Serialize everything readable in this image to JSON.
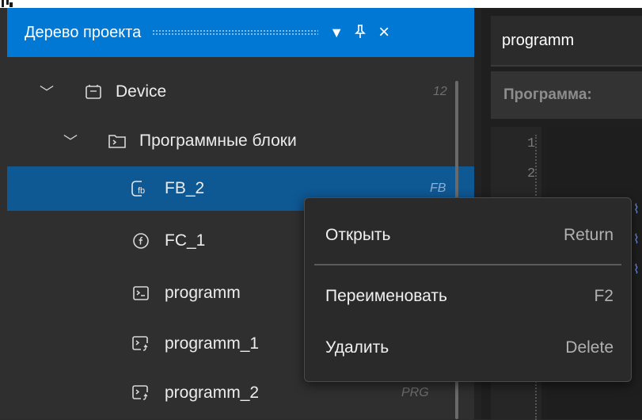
{
  "window_top": {
    "fragment_glyph": ""
  },
  "project_tree": {
    "title": "Дерево проекта",
    "header_icons": {
      "dropdown": "chevron-down-icon",
      "pin": "pin-icon",
      "close": "close-icon"
    },
    "items": [
      {
        "label": "Device",
        "badge": "12",
        "icon": "device-icon",
        "expanded": true
      },
      {
        "label": "Программные блоки",
        "badge": "",
        "icon": "folder-program-icon",
        "expanded": true
      },
      {
        "label": "FB_2",
        "badge": "FB",
        "icon": "function-block-icon",
        "selected": true
      },
      {
        "label": "FC_1",
        "badge": "",
        "icon": "function-icon"
      },
      {
        "label": "programm",
        "badge": "",
        "icon": "program-icon"
      },
      {
        "label": "programm_1",
        "badge": "",
        "icon": "program-linked-icon"
      },
      {
        "label": "programm_2",
        "badge": "PRG",
        "icon": "program-linked-icon"
      }
    ]
  },
  "editor": {
    "tab_label": "programm",
    "header_label": "Программа:",
    "line_numbers": [
      "1",
      "2"
    ]
  },
  "context_menu": {
    "items": [
      {
        "label": "Открыть",
        "shortcut": "Return"
      },
      {
        "label": "Переименовать",
        "shortcut": "F2"
      },
      {
        "label": "Удалить",
        "shortcut": "Delete"
      }
    ]
  },
  "colors": {
    "accent": "#0078d4",
    "selection": "#0e5894",
    "panel_bg": "#2f2f2f",
    "menu_bg": "#2a2a2a"
  }
}
